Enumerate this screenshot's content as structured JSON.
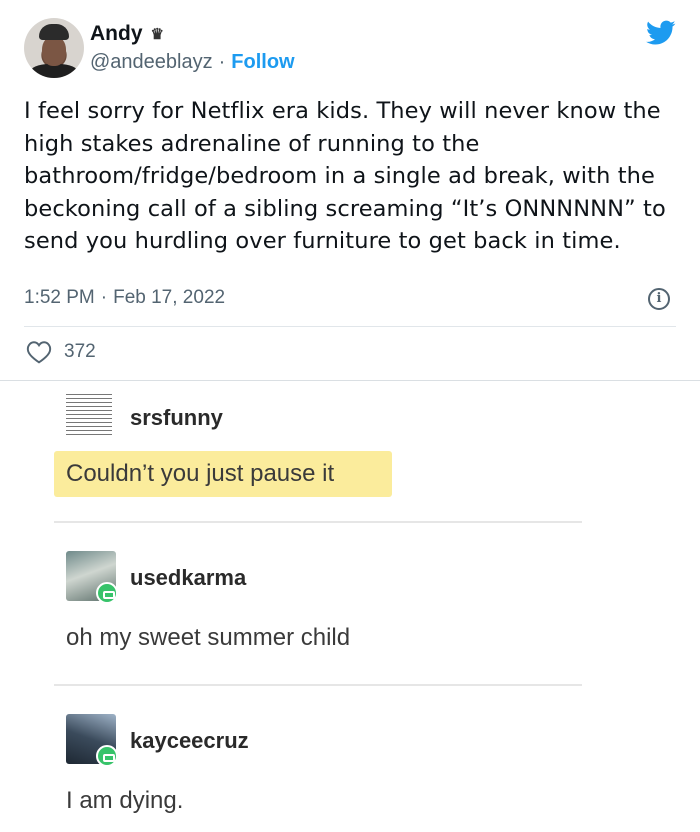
{
  "tweet": {
    "author_name": "Andy",
    "crown_glyph": "♛",
    "handle": "@andeeblayz",
    "separator": "·",
    "follow_label": "Follow",
    "text": "I feel sorry for Netflix era kids. They will never know the high stakes adrenaline of running to the bathroom/fridge/bedroom in a single ad break, with the beckoning call of a sibling screaming “It’s ONNNNNN” to send you hurdling over furniture to get back in time.",
    "time": "1:52 PM",
    "date": "Feb 17, 2022",
    "info_glyph": "i",
    "like_count": "372",
    "icons": [
      "twitter-bird-icon",
      "info-icon",
      "heart-icon",
      "crown-icon"
    ],
    "colors": {
      "accent": "#1d9bf0",
      "muted": "#536471"
    }
  },
  "tumblr_thread": {
    "posts": [
      {
        "username": "srsfunny",
        "text": "Couldn’t you just pause it",
        "highlighted": true
      },
      {
        "username": "usedkarma",
        "text": "oh my sweet summer child",
        "highlighted": false
      },
      {
        "username": "kayceecruz",
        "text": "I am dying.",
        "highlighted": false
      }
    ],
    "colors": {
      "highlight": "#fbec9c"
    }
  }
}
